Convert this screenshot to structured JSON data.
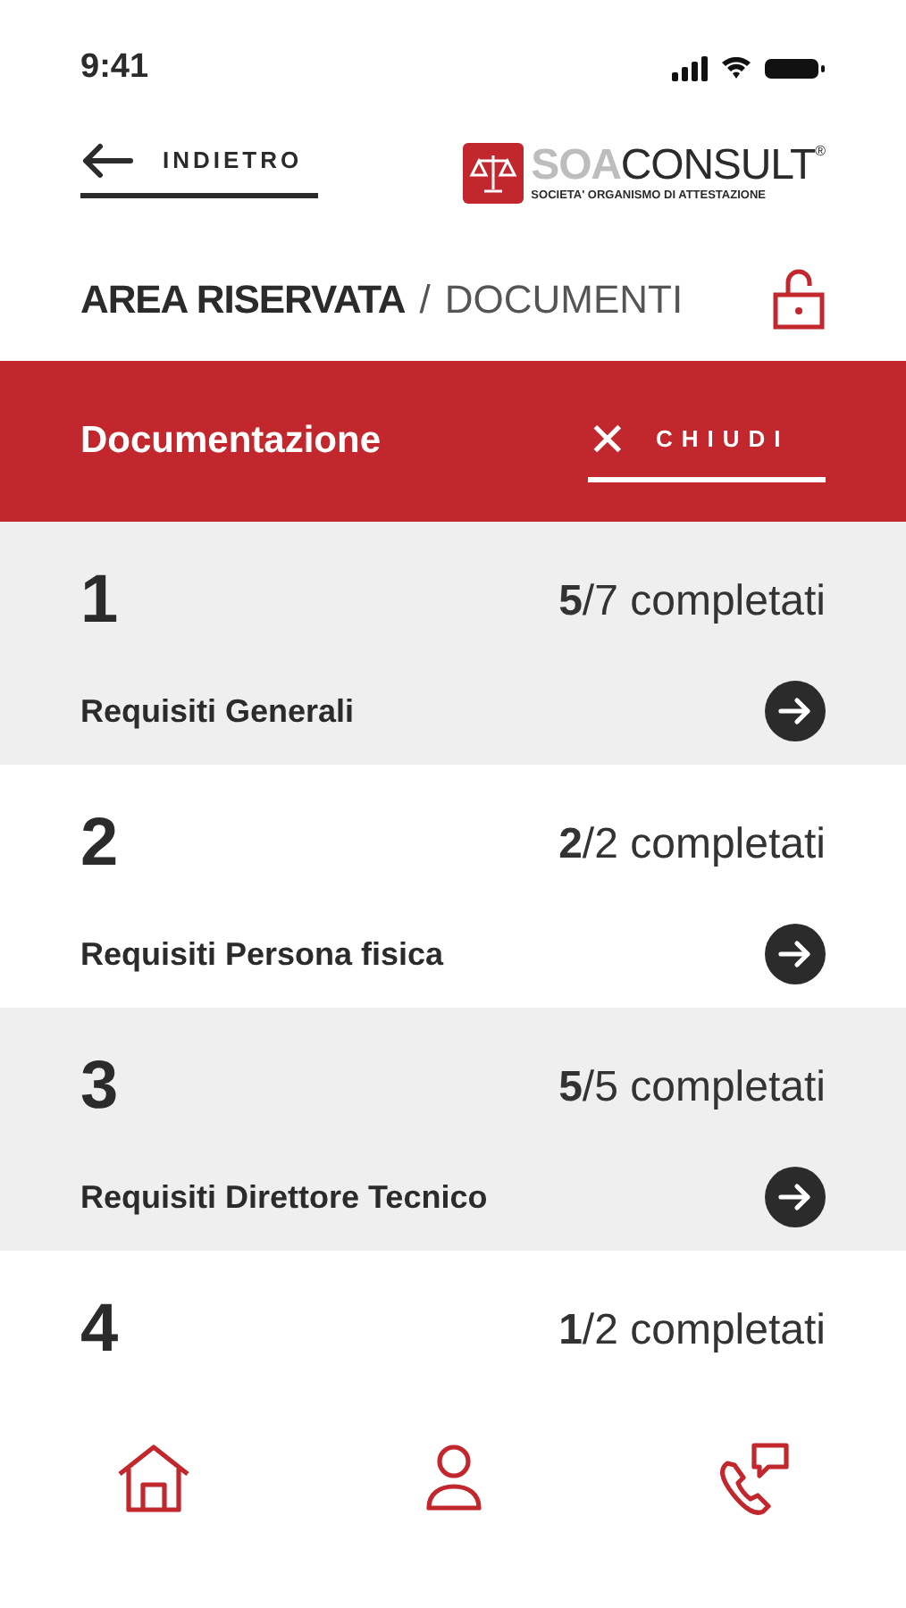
{
  "status_bar": {
    "time": "9:41"
  },
  "header": {
    "back": "INDIETRO",
    "logo": {
      "brand_light": "SOA",
      "brand_dark": "CONSULT",
      "registered": "®",
      "tagline": "SOCIETA' ORGANISMO DI ATTESTAZIONE"
    }
  },
  "breadcrumb": {
    "section": "AREA RISERVATA",
    "separator": "/",
    "page": "DOCUMENTI"
  },
  "panel": {
    "title": "Documentazione",
    "close_icon": "✕",
    "close": "CHIUDI"
  },
  "items": [
    {
      "number": "1",
      "progress": "**5**/7 completati",
      "label": "Requisiti Generali"
    },
    {
      "number": "2",
      "progress": "**2**/2 completati",
      "label": "Requisiti Persona fisica"
    },
    {
      "number": "3",
      "progress": "**5**/5 completati",
      "label": "Requisiti Direttore Tecnico"
    },
    {
      "number": "4",
      "progress": "**1**/2 completati"
    }
  ]
}
